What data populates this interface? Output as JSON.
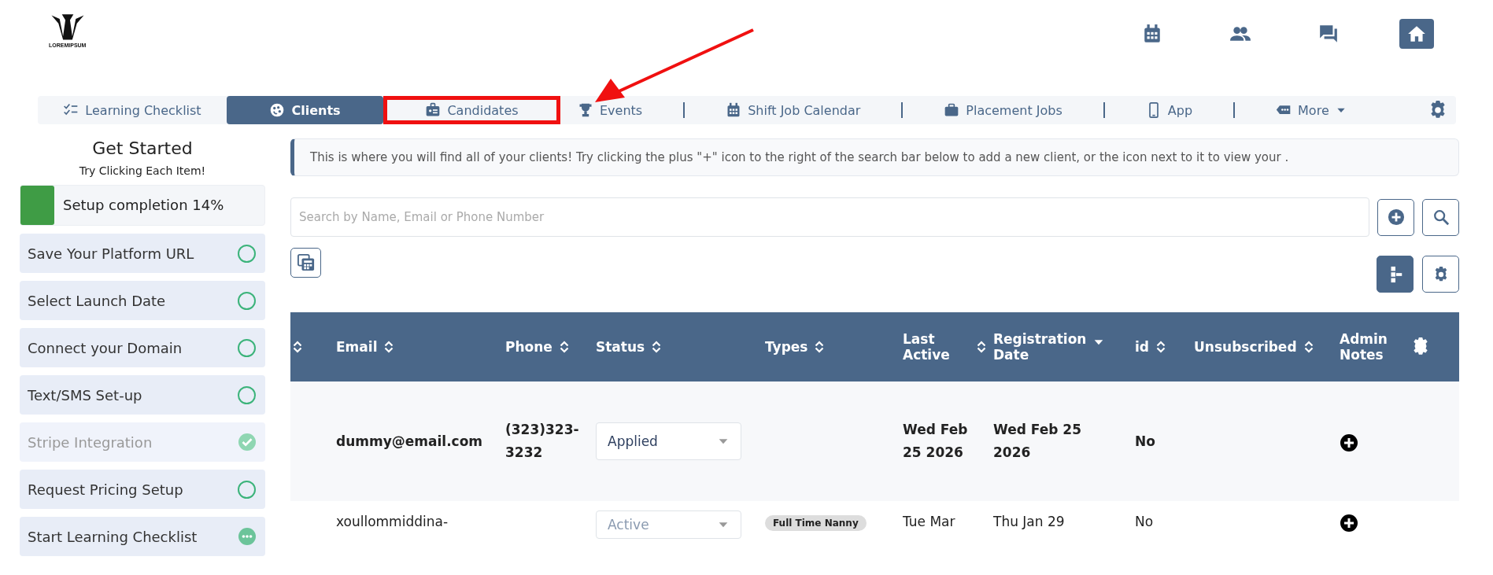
{
  "logo": {
    "text": "LOREMIPSUM"
  },
  "header_icons": [
    {
      "kind": "calendar",
      "selected": false
    },
    {
      "kind": "people",
      "selected": false
    },
    {
      "kind": "chat",
      "selected": false
    },
    {
      "kind": "home",
      "selected": true
    }
  ],
  "nav": {
    "tabs": [
      {
        "label": "Learning Checklist",
        "kind": "checklist",
        "selected": false,
        "highlighted": false,
        "divider": false,
        "dropdown": false
      },
      {
        "label": "Clients",
        "kind": "clients",
        "selected": true,
        "highlighted": false,
        "divider": false,
        "dropdown": false
      },
      {
        "label": "Candidates",
        "kind": "idcard",
        "selected": false,
        "highlighted": true,
        "divider": false,
        "dropdown": false
      },
      {
        "label": "Events",
        "kind": "trophy",
        "selected": false,
        "highlighted": false,
        "divider": true,
        "dropdown": false
      },
      {
        "label": "Shift Job Calendar",
        "kind": "calendar",
        "selected": false,
        "highlighted": false,
        "divider": true,
        "dropdown": false
      },
      {
        "label": "Placement Jobs",
        "kind": "briefcase",
        "selected": false,
        "highlighted": false,
        "divider": true,
        "dropdown": false
      },
      {
        "label": "App",
        "kind": "phone",
        "selected": false,
        "highlighted": false,
        "divider": true,
        "dropdown": false
      },
      {
        "label": "More",
        "kind": "tag",
        "selected": false,
        "highlighted": false,
        "divider": false,
        "dropdown": true
      }
    ]
  },
  "sidebar": {
    "title": "Get Started",
    "subtitle": "Try Clicking Each Item!",
    "progress": {
      "label": "Setup completion 14%",
      "level": 0.14
    },
    "items": [
      {
        "label": "Save Your Platform URL",
        "kind": "todo"
      },
      {
        "label": "Select Launch Date",
        "kind": "todo"
      },
      {
        "label": "Connect your Domain",
        "kind": "todo"
      },
      {
        "label": "Text/SMS Set-up",
        "kind": "todo"
      },
      {
        "label": "Stripe Integration",
        "kind": "done"
      },
      {
        "label": "Request Pricing Setup",
        "kind": "todo"
      },
      {
        "label": "Start Learning Checklist",
        "kind": "in_progress"
      }
    ]
  },
  "info": "This is where you will find all of your clients! Try clicking the plus \"+\" icon to the right of the search bar below to add a new client, or the icon next to it to view your .",
  "search": {
    "placeholder": "Search by Name, Email or Phone Number"
  },
  "table": {
    "columns": [
      {
        "kind": "sortable"
      },
      {
        "label": "Email",
        "kind": "sortable"
      },
      {
        "label": "Phone",
        "kind": "sortable"
      },
      {
        "label": "Status",
        "kind": "sortable"
      },
      {
        "label": "Types",
        "kind": "sortable"
      },
      {
        "label": "Last Active",
        "kind": "sortable"
      },
      {
        "label": "Registration Date",
        "kind": "sorted_desc"
      },
      {
        "label": "id",
        "kind": "sortable"
      },
      {
        "label": "Unsubscribed",
        "kind": "sortable"
      },
      {
        "label": "Admin Notes",
        "kind": "plain"
      }
    ],
    "rows": [
      {
        "highlighted": true,
        "email": "dummy@email.com",
        "phone": "(323)323-3232",
        "status": "Applied",
        "types": [],
        "last_active": "Wed Feb 25 2026",
        "registration": "Wed Feb 25 2026",
        "id": "No"
      },
      {
        "highlighted": false,
        "email": "xoullommiddina-",
        "status": "Active",
        "types": [
          "Full Time Nanny"
        ],
        "last_active": "Tue Mar",
        "registration": "Thu Jan 29",
        "id": "No"
      }
    ]
  }
}
